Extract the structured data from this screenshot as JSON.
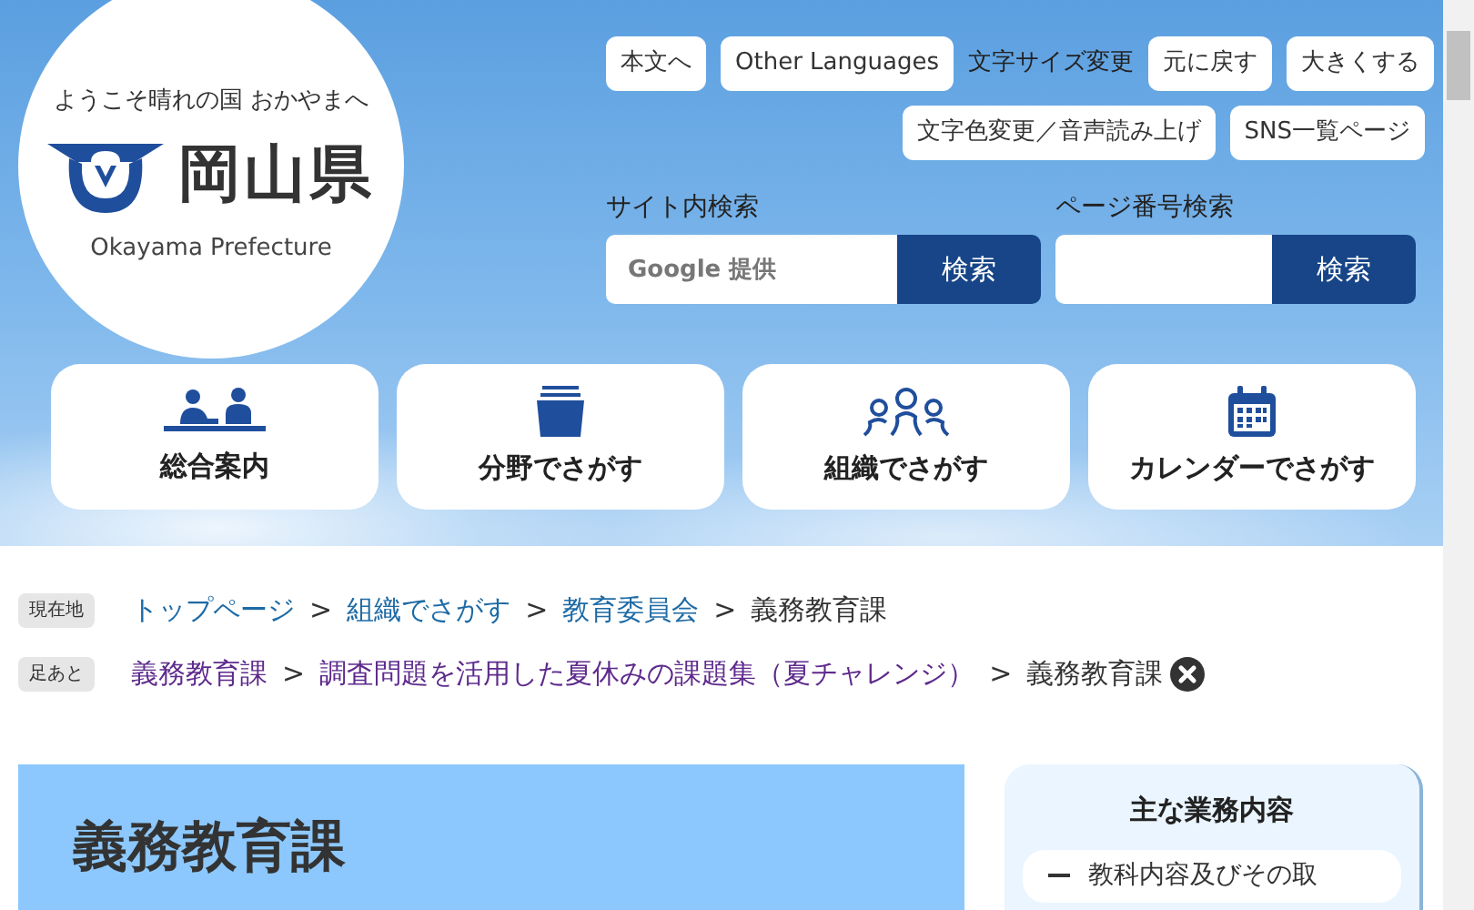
{
  "logo": {
    "tagline": "ようこそ晴れの国 おかやまへ",
    "name": "岡山県",
    "subtitle": "Okayama Prefecture"
  },
  "top_links": [
    "本文へ",
    "Other Languages"
  ],
  "font_size": {
    "label": "文字サイズ変更",
    "buttons": [
      "元に戻す",
      "大きくする"
    ]
  },
  "sub_links": [
    "文字色変更／音声読み上げ",
    "SNS一覧ページ"
  ],
  "searches": [
    {
      "label": "サイト内検索",
      "placeholder": "Google 提供",
      "button": "検索"
    },
    {
      "label": "ページ番号検索",
      "button": "検索"
    }
  ],
  "nav_cards": [
    {
      "label": "総合案内",
      "kind": "guide"
    },
    {
      "label": "分野でさがす",
      "kind": "field"
    },
    {
      "label": "組織でさがす",
      "kind": "organization"
    },
    {
      "label": "カレンダーでさがす",
      "kind": "calendar"
    }
  ],
  "breadcrumbs": [
    {
      "tag": "現在地",
      "separator": ">",
      "removable": false,
      "items": [
        {
          "text": "トップページ",
          "link": true,
          "visited": false
        },
        {
          "text": "組織でさがす",
          "link": true,
          "visited": false
        },
        {
          "text": "教育委員会",
          "link": true,
          "visited": false
        },
        {
          "text": "義務教育課",
          "link": false,
          "visited": false
        }
      ]
    },
    {
      "tag": "足あと",
      "separator": ">",
      "removable": true,
      "items": [
        {
          "text": "義務教育課",
          "link": true,
          "visited": true
        },
        {
          "text": "調査問題を活用した夏休みの課題集（夏チャレンジ）",
          "link": true,
          "visited": true
        },
        {
          "text": "義務教育課",
          "link": false,
          "visited": false
        }
      ]
    }
  ],
  "page_title": "義務教育課",
  "sidebar": {
    "title": "主な業務内容",
    "items": [
      "教科内容及びその取"
    ]
  }
}
